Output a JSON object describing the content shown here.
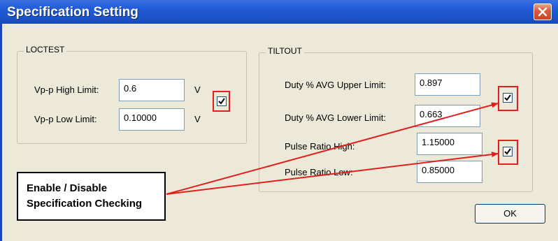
{
  "window": {
    "title": "Specification Setting"
  },
  "loctest": {
    "label": "LOCTEST",
    "high_label": "Vp-p High Limit:",
    "high_value": "0.6",
    "high_unit": "V",
    "low_label": "Vp-p Low Limit:",
    "low_value": "0.10000",
    "low_unit": "V",
    "enabled": true
  },
  "tiltout": {
    "label": "TILTOUT",
    "duty_upper_label": "Duty % AVG Upper Limit:",
    "duty_upper_value": "0.897",
    "duty_lower_label": "Duty % AVG Lower Limit:",
    "duty_lower_value": "0.663",
    "pulse_high_label": "Pulse Ratio High:",
    "pulse_high_value": "1.15000",
    "pulse_low_label": "Pulse Ratio Low:",
    "pulse_low_value": "0.85000",
    "duty_enabled": true,
    "pulse_enabled": true
  },
  "callout": {
    "line1": "Enable / Disable",
    "line2": "Specification Checking"
  },
  "buttons": {
    "ok": "OK"
  },
  "colors": {
    "titlebar": "#245edb",
    "dialog_bg": "#ece9d8",
    "highlight": "#e0201c",
    "close": "#d9583a"
  }
}
